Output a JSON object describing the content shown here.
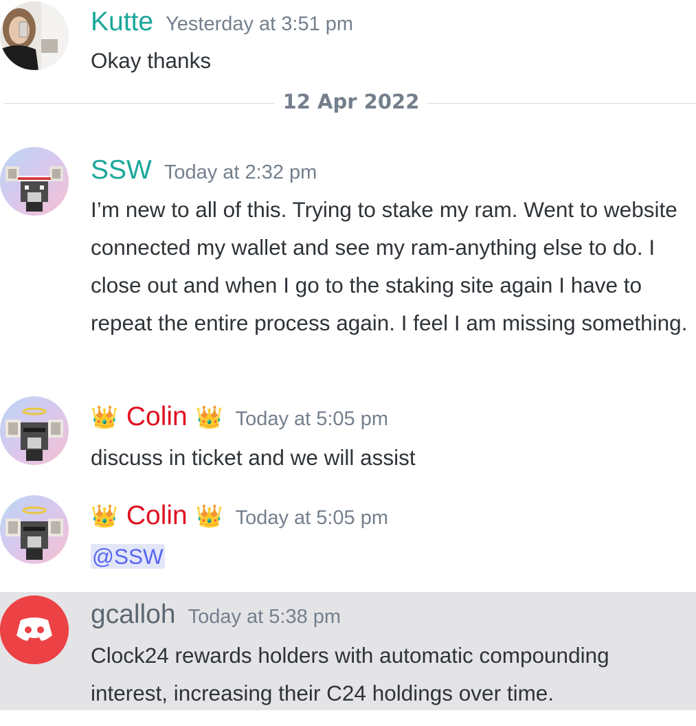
{
  "colors": {
    "teal_username": "#1aa79a",
    "red_username": "#e0101f",
    "gray_username": "#5b6770",
    "timestamp": "#747f8d",
    "mention_bg": "#e3e6f8",
    "mention_fg": "#5865f2",
    "discord_red": "#ed4245"
  },
  "messages": [
    {
      "username": "Kutte",
      "timestamp": "Yesterday at 3:51 pm",
      "text": "Okay thanks",
      "avatar": "photo-avatar"
    },
    {
      "username": "SSW",
      "timestamp": "Today at 2:32 pm",
      "text": "I’m new to all of this. Trying to stake my ram. Went to website connected my wallet and see my ram-anything else to do. I close out and when I go to the staking site again I have to repeat the entire process again. I feel I am missing something.",
      "avatar": "goat-pixel-avatar"
    },
    {
      "username": "Colin",
      "timestamp": "Today at 5:05 pm",
      "text": "discuss in ticket and we will assist",
      "crown": "👑",
      "avatar": "goat-halo-avatar"
    },
    {
      "username": "Colin",
      "timestamp": "Today at 5:05 pm",
      "mention": "@SSW",
      "crown": "👑",
      "avatar": "goat-halo-avatar"
    },
    {
      "username": "gcalloh",
      "timestamp": "Today at 5:38 pm",
      "text": "Clock24 rewards holders with automatic compounding interest, increasing their C24 holdings over time.",
      "avatar": "discord-logo-avatar"
    }
  ],
  "date_divider": "12 Apr 2022"
}
